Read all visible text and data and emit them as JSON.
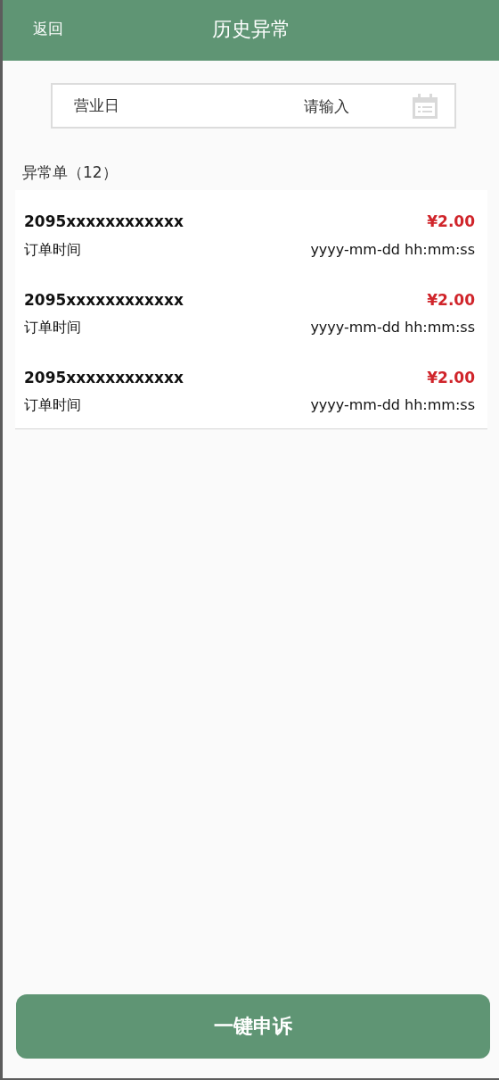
{
  "header": {
    "back": "返回",
    "title": "历史异常"
  },
  "filter": {
    "label": "营业日",
    "placeholder": "请输入"
  },
  "section": {
    "title": "异常单（12）"
  },
  "orders": [
    {
      "number": "2095xxxxxxxxxxxx",
      "amount": "¥2.00",
      "time_label": "订单时间",
      "time": "yyyy-mm-dd hh:mm:ss"
    },
    {
      "number": "2095xxxxxxxxxxxx",
      "amount": "¥2.00",
      "time_label": "订单时间",
      "time": "yyyy-mm-dd hh:mm:ss"
    },
    {
      "number": "2095xxxxxxxxxxxx",
      "amount": "¥2.00",
      "time_label": "订单时间",
      "time": "yyyy-mm-dd hh:mm:ss"
    }
  ],
  "action_button": "一键申诉"
}
